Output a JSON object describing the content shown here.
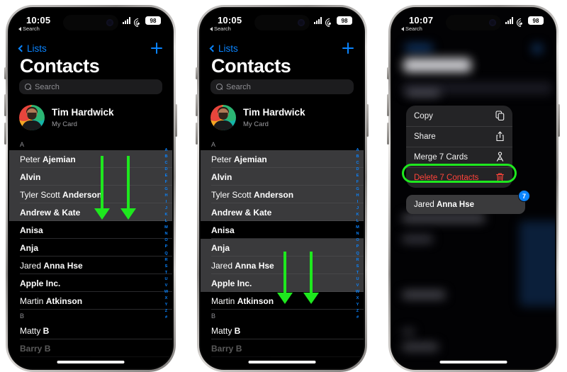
{
  "statusbar": {
    "time_1": "10:05",
    "time_2": "10:05",
    "time_3": "10:07",
    "back_label": "Search",
    "battery": "98"
  },
  "nav": {
    "back_label": "Lists",
    "add_icon": "plus-icon"
  },
  "header": {
    "title": "Contacts"
  },
  "search": {
    "placeholder": "Search",
    "icon": "search-icon"
  },
  "mycard": {
    "name": "Tim Hardwick",
    "subtitle": "My Card",
    "avatar": "avatar"
  },
  "list": {
    "section_a": "A",
    "section_b": "B",
    "rows": [
      {
        "first": "Peter ",
        "last": "Ajemian"
      },
      {
        "first": "",
        "last": "Alvin"
      },
      {
        "first": "Tyler Scott ",
        "last": "Anderson"
      },
      {
        "first": "",
        "last": "Andrew & Kate"
      },
      {
        "first": "",
        "last": "Anisa"
      },
      {
        "first": "",
        "last": "Anja"
      },
      {
        "first": "Jared ",
        "last": "Anna Hse"
      },
      {
        "first": "",
        "last": "Apple Inc."
      },
      {
        "first": "Martin ",
        "last": "Atkinson"
      }
    ],
    "row_b": {
      "first": "Matty ",
      "last": "B"
    },
    "index_letters": "ABCDEFGHIJKLMNOPQRSTUVWXYZ#"
  },
  "phone1": {
    "selected_indices": [
      0,
      1,
      2,
      3
    ],
    "arrow_count": 2
  },
  "phone2": {
    "selected_indices": [
      0,
      1,
      2,
      3,
      5,
      6,
      7
    ],
    "arrow_count": 2
  },
  "phone3": {
    "menu": [
      {
        "label": "Copy",
        "icon": "copy-icon",
        "danger": false
      },
      {
        "label": "Share",
        "icon": "share-icon",
        "danger": false
      },
      {
        "label": "Merge 7 Cards",
        "icon": "merge-icon",
        "danger": false
      },
      {
        "label": "Delete 7 Contacts",
        "icon": "trash-icon",
        "danger": true
      }
    ],
    "selected_card": {
      "first": "Jared ",
      "last": "Anna Hse"
    },
    "badge_count": "7"
  },
  "colors": {
    "accent_blue": "#0a84ff",
    "danger_red": "#ff453a",
    "highlight_green": "#1ee81e",
    "selected_row": "#3a3a3c",
    "screen_bg": "#000000"
  }
}
